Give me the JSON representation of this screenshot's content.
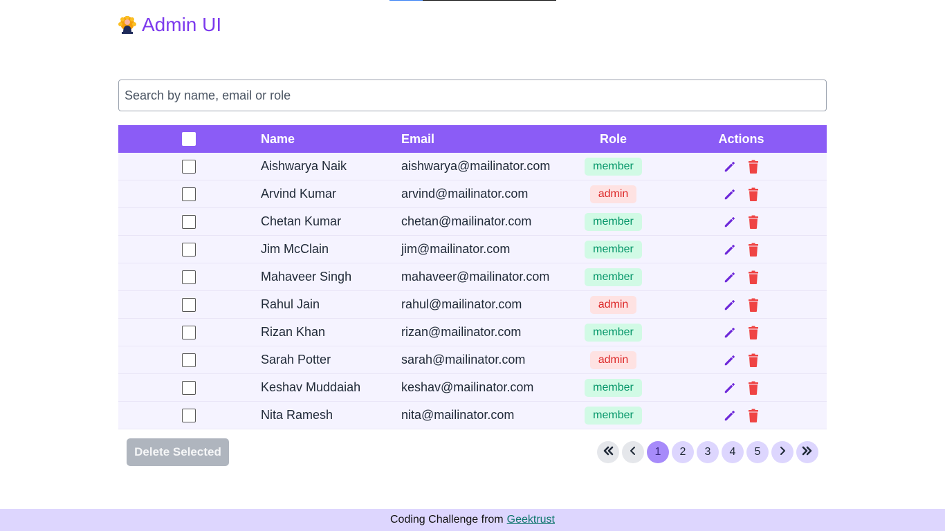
{
  "app": {
    "title": "Admin UI",
    "logo_icon": "admin-avatar-icon",
    "accent_color": "#7c3aed",
    "header_color": "#8b5cf6"
  },
  "search": {
    "placeholder": "Search by name, email or role",
    "value": ""
  },
  "table": {
    "columns": {
      "select_all": "",
      "name": "Name",
      "email": "Email",
      "role": "Role",
      "actions": "Actions"
    },
    "rows": [
      {
        "name": "Aishwarya Naik",
        "email": "aishwarya@mailinator.com",
        "role": "member",
        "checked": false
      },
      {
        "name": "Arvind Kumar",
        "email": "arvind@mailinator.com",
        "role": "admin",
        "checked": false
      },
      {
        "name": "Chetan Kumar",
        "email": "chetan@mailinator.com",
        "role": "member",
        "checked": false
      },
      {
        "name": "Jim McClain",
        "email": "jim@mailinator.com",
        "role": "member",
        "checked": false
      },
      {
        "name": "Mahaveer Singh",
        "email": "mahaveer@mailinator.com",
        "role": "member",
        "checked": false
      },
      {
        "name": "Rahul Jain",
        "email": "rahul@mailinator.com",
        "role": "admin",
        "checked": false
      },
      {
        "name": "Rizan Khan",
        "email": "rizan@mailinator.com",
        "role": "member",
        "checked": false
      },
      {
        "name": "Sarah Potter",
        "email": "sarah@mailinator.com",
        "role": "admin",
        "checked": false
      },
      {
        "name": "Keshav Muddaiah",
        "email": "keshav@mailinator.com",
        "role": "member",
        "checked": false
      },
      {
        "name": "Nita Ramesh",
        "email": "nita@mailinator.com",
        "role": "member",
        "checked": false
      }
    ],
    "row_actions": {
      "edit_icon": "pencil-icon",
      "delete_icon": "trash-icon",
      "edit_color": "#6d28d9",
      "delete_color": "#ef4444"
    }
  },
  "footer_actions": {
    "delete_selected_label": "Delete Selected"
  },
  "pagination": {
    "first_icon": "double-chevron-left-icon",
    "prev_icon": "chevron-left-icon",
    "next_icon": "chevron-right-icon",
    "last_icon": "double-chevron-right-icon",
    "pages": [
      "1",
      "2",
      "3",
      "4",
      "5"
    ],
    "current_page": "1"
  },
  "footer": {
    "text": "Coding Challenge from",
    "link_text": "Geektrust"
  }
}
